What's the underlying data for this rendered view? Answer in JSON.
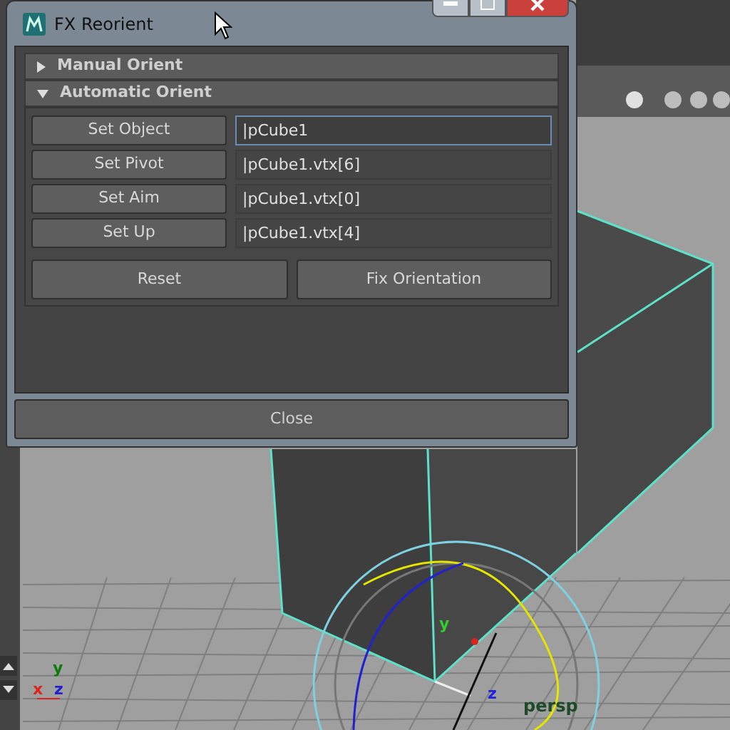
{
  "window": {
    "title": "FX Reorient"
  },
  "sections": [
    {
      "label": "Manual Orient",
      "expanded": false
    },
    {
      "label": "Automatic Orient",
      "expanded": true,
      "rows": [
        {
          "button": "Set Object",
          "value": "|pCube1",
          "focused": true
        },
        {
          "button": "Set Pivot",
          "value": "|pCube1.vtx[6]",
          "focused": false
        },
        {
          "button": "Set Aim",
          "value": "|pCube1.vtx[0]",
          "focused": false
        },
        {
          "button": "Set Up",
          "value": "|pCube1.vtx[4]",
          "focused": false
        }
      ],
      "actions": [
        "Reset",
        "Fix Orientation"
      ]
    }
  ],
  "close_button": "Close",
  "viewport": {
    "camera_label": "persp",
    "manipulator_labels": [
      {
        "text": "y",
        "color": "#33cc33"
      },
      {
        "text": "z",
        "color": "#2222dd"
      }
    ],
    "axis_labels": [
      {
        "text": "y",
        "color": "#0e7a0e"
      },
      {
        "text": "x",
        "color": "#dd2222"
      },
      {
        "text": "z",
        "color": "#2222cc"
      }
    ]
  }
}
